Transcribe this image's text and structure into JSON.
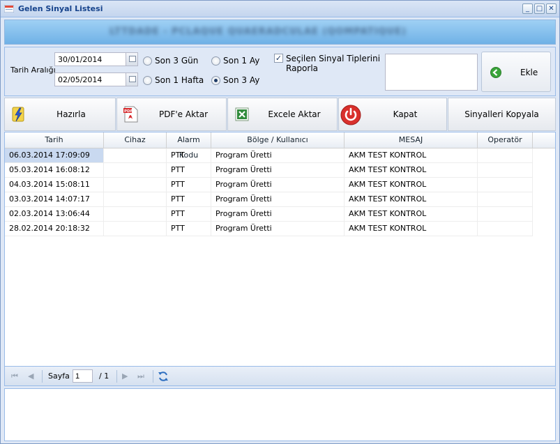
{
  "window": {
    "title": "Gelen Sinyal Listesi",
    "min_label": "_",
    "max_label": "□",
    "close_label": "✕"
  },
  "banner": {
    "text": "LTTDADE - PCLAQUE QUAERADCULAE (QOMPATIQUE)"
  },
  "filter": {
    "date_range_label": "Tarih Aralığı",
    "date_from": "30/01/2014",
    "date_to": "02/05/2014",
    "radios": {
      "last3days": "Son 3 Gün",
      "last1month": "Son 1 Ay",
      "last1week": "Son 1 Hafta",
      "last3months": "Son 3 Ay"
    },
    "selected_radio": "last3months",
    "report_checkbox_label": "Seçilen Sinyal Tiplerini Raporla",
    "report_checked": true,
    "add_label": "Ekle"
  },
  "toolbar": {
    "prepare": "Hazırla",
    "pdf": "PDF'e Aktar",
    "excel": "Excele Aktar",
    "close": "Kapat",
    "copy": "Sinyalleri Kopyala"
  },
  "grid": {
    "columns": [
      "Tarih",
      "Cihaz",
      "Alarm Kodu",
      "Bölge / Kullanıcı",
      "MESAJ",
      "Operatör"
    ],
    "rows": [
      [
        "06.03.2014 17:09:09",
        "",
        "PTT",
        "Program Üretti",
        "AKM TEST KONTROL",
        ""
      ],
      [
        "05.03.2014 16:08:12",
        "",
        "PTT",
        "Program Üretti",
        "AKM TEST KONTROL",
        ""
      ],
      [
        "04.03.2014 15:08:11",
        "",
        "PTT",
        "Program Üretti",
        "AKM TEST KONTROL",
        ""
      ],
      [
        "03.03.2014 14:07:17",
        "",
        "PTT",
        "Program Üretti",
        "AKM TEST KONTROL",
        ""
      ],
      [
        "02.03.2014 13:06:44",
        "",
        "PTT",
        "Program Üretti",
        "AKM TEST KONTROL",
        ""
      ],
      [
        "28.02.2014 20:18:32",
        "",
        "PTT",
        "Program Üretti",
        "AKM TEST KONTROL",
        ""
      ]
    ]
  },
  "pager": {
    "page_label": "Sayfa",
    "page_value": "1",
    "of_label": "/ 1"
  },
  "colors": {
    "banner": "#7fbdea",
    "panel": "#dfe8f6",
    "selected_row": "#c9d9f0",
    "title_text": "#15428b"
  }
}
